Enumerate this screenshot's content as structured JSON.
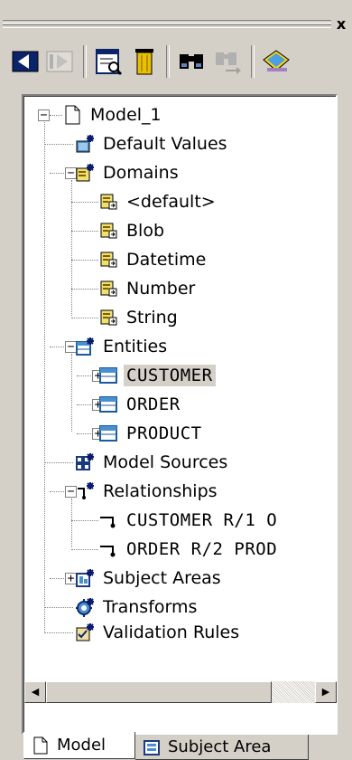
{
  "window": {
    "close_glyph": "x"
  },
  "toolbar": {
    "buttons": [
      {
        "name": "tree-view-icon",
        "enabled": true
      },
      {
        "name": "panel-view-icon",
        "enabled": false
      },
      {
        "name": "properties-icon",
        "enabled": true
      },
      {
        "name": "delete-icon",
        "enabled": true
      },
      {
        "name": "find-icon",
        "enabled": true
      },
      {
        "name": "find-next-icon",
        "enabled": false
      },
      {
        "name": "help-icon",
        "enabled": true
      }
    ]
  },
  "tree": {
    "items": [
      {
        "label": "Model_1",
        "icon": "model-icon"
      },
      {
        "label": "Default Values",
        "icon": "default-values-icon"
      },
      {
        "label": "Domains",
        "icon": "domains-icon"
      },
      {
        "label": "<default>",
        "icon": "domain-icon"
      },
      {
        "label": "Blob",
        "icon": "domain-icon"
      },
      {
        "label": "Datetime",
        "icon": "domain-icon"
      },
      {
        "label": "Number",
        "icon": "domain-icon"
      },
      {
        "label": "String",
        "icon": "domain-icon"
      },
      {
        "label": "Entities",
        "icon": "entities-icon"
      },
      {
        "label": "CUSTOMER",
        "icon": "entity-icon"
      },
      {
        "label": "ORDER",
        "icon": "entity-icon"
      },
      {
        "label": "PRODUCT",
        "icon": "entity-icon"
      },
      {
        "label": "Model Sources",
        "icon": "model-sources-icon"
      },
      {
        "label": "Relationships",
        "icon": "relationships-icon"
      },
      {
        "label": "CUSTOMER R/1 O",
        "icon": "relationship-icon"
      },
      {
        "label": "ORDER R/2 PROD",
        "icon": "relationship-icon"
      },
      {
        "label": "Subject Areas",
        "icon": "subject-areas-icon"
      },
      {
        "label": "Transforms",
        "icon": "transforms-icon"
      },
      {
        "label": "Validation Rules",
        "icon": "validation-rules-icon"
      }
    ],
    "expander_minus": "−",
    "expander_plus": "+"
  },
  "scrollbar": {
    "left_arrow": "◀",
    "right_arrow": "▶"
  },
  "tabs": [
    {
      "label": "Model",
      "active": true
    },
    {
      "label": "Subject Area",
      "active": false
    }
  ]
}
